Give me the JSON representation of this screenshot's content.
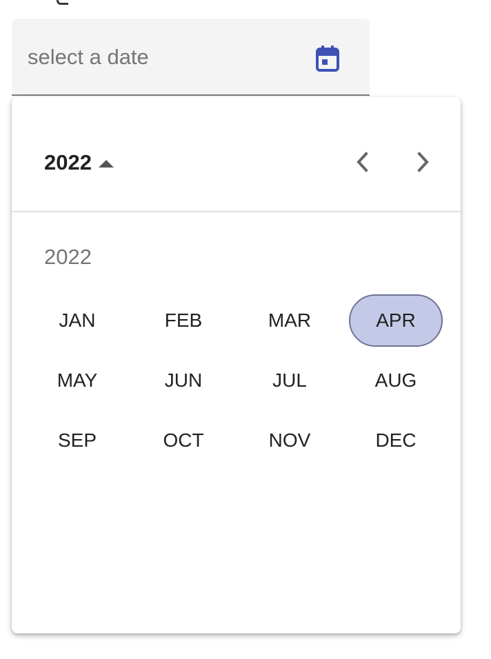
{
  "date_field": {
    "placeholder": "select a date",
    "icon": "calendar-icon",
    "icon_color": "#3f51b5"
  },
  "picker": {
    "header_year": "2022",
    "toggle_icon": "arrow-up-icon",
    "prev_icon": "chevron-left-icon",
    "next_icon": "chevron-right-icon",
    "grid_year": "2022",
    "selected_month": "APR",
    "months": [
      {
        "label": "JAN"
      },
      {
        "label": "FEB"
      },
      {
        "label": "MAR"
      },
      {
        "label": "APR"
      },
      {
        "label": "MAY"
      },
      {
        "label": "JUN"
      },
      {
        "label": "JUL"
      },
      {
        "label": "AUG"
      },
      {
        "label": "SEP"
      },
      {
        "label": "OCT"
      },
      {
        "label": "NOV"
      },
      {
        "label": "DEC"
      }
    ],
    "colors": {
      "selected_fill": "#c5c9e8",
      "selected_border": "#6f7396"
    }
  }
}
